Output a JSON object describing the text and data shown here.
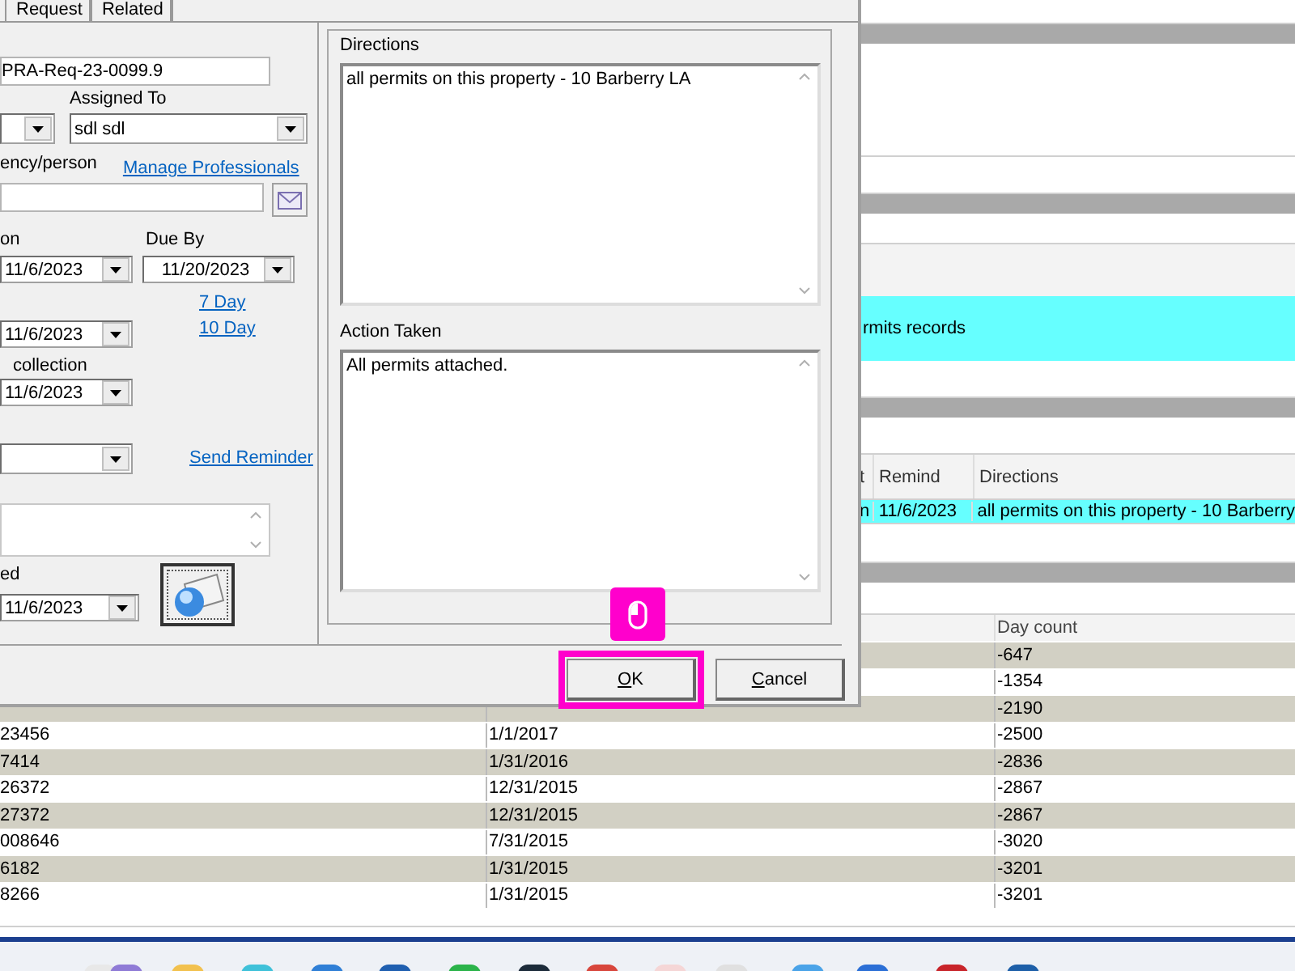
{
  "page": {
    "highlight_row": {
      "text": "rmits records"
    },
    "grid": {
      "columns": [
        "t",
        "Remind",
        "Directions"
      ],
      "row": [
        "n",
        "11/6/2023",
        "all permits on this property - 10 Barberry"
      ]
    },
    "table": {
      "columns": {
        "column_3": "Day count"
      },
      "rows": [
        {
          "column_3": "-647"
        },
        {
          "column_3": "-1354"
        },
        {
          "column_3": "-2190"
        },
        {
          "column_1": "23456",
          "column_2": "1/1/2017",
          "column_3": "-2500"
        },
        {
          "column_1": "7414",
          "column_2": "1/31/2016",
          "column_3": "-2836"
        },
        {
          "column_1": "26372",
          "column_2": "12/31/2015",
          "column_3": "-2867"
        },
        {
          "column_1": "27372",
          "column_2": "12/31/2015",
          "column_3": "-2867"
        },
        {
          "column_1": "008646",
          "column_2": "7/31/2015",
          "column_3": "-3020"
        },
        {
          "column_1": "6182",
          "column_2": "1/31/2015",
          "column_3": "-3201"
        },
        {
          "column_1": "8266",
          "column_2": "1/31/2015",
          "column_3": "-3201"
        }
      ]
    }
  },
  "dialog": {
    "tabs": [
      {
        "label": "Request",
        "selected": false
      },
      {
        "label": "Related",
        "selected": false
      }
    ],
    "reference_field": {
      "value": "PRA-Req-23-0099.9"
    },
    "assigned_to": {
      "label": "Assigned To",
      "value": "sdl sdl"
    },
    "agency": {
      "label": "ency/person",
      "link": "Manage Professionals"
    },
    "received": {
      "label": "on",
      "value": "11/6/2023"
    },
    "due_by": {
      "label": "Due By",
      "value": "11/20/2023"
    },
    "date_2": {
      "value": "11/6/2023"
    },
    "due_links": [
      "7 Day",
      "10 Day"
    ],
    "collection": {
      "label": "collection",
      "value": "11/6/2023"
    },
    "reminder_link": "Send Reminder",
    "completed": {
      "label": "ed",
      "value": "11/6/2023"
    },
    "directions": {
      "label": "Directions",
      "value": "all permits on this property - 10 Barberry LA"
    },
    "action_taken": {
      "label": "Action Taken",
      "value": "All permits attached."
    },
    "buttons": [
      {
        "label": "OK",
        "highlighted": true
      },
      {
        "label": "Cancel",
        "highlighted": false
      }
    ]
  }
}
